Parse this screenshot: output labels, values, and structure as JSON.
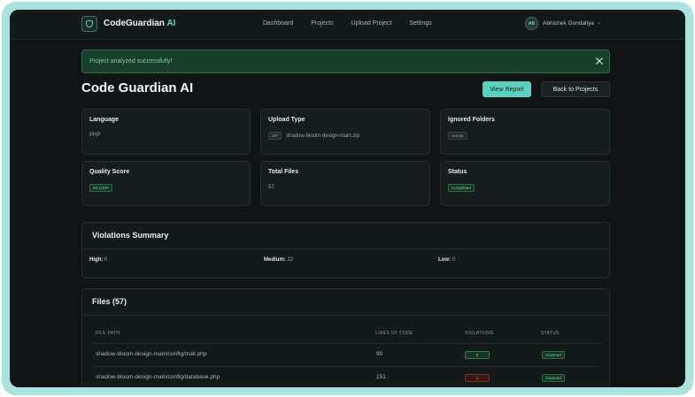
{
  "nav": {
    "brand_main": "CodeGuardian",
    "brand_accent": "AI",
    "links": [
      "Dashboard",
      "Projects",
      "Upload Project",
      "Settings"
    ],
    "user_initials": "AB",
    "user_name": "Abhishek Gondaliya"
  },
  "alert": {
    "message": "Project analyzed successfully!"
  },
  "page": {
    "title": "Code Guardian AI",
    "view_report": "View Report",
    "back_to_projects": "Back to Projects"
  },
  "cards": {
    "language": {
      "label": "Language",
      "value": "PHP"
    },
    "upload_type": {
      "label": "Upload Type",
      "tag": "ZIP",
      "value": "shadow-bloom-design-main.zip"
    },
    "ignored_folders": {
      "label": "Ignored Folders",
      "tag": "vendor"
    },
    "quality_score": {
      "label": "Quality Score",
      "badge": "98.1/100"
    },
    "total_files": {
      "label": "Total Files",
      "value": "57"
    },
    "status": {
      "label": "Status",
      "badge": "Completed"
    }
  },
  "violations": {
    "title": "Violations Summary",
    "high_label": "High:",
    "high_value": "0",
    "medium_label": "Medium:",
    "medium_value": "22",
    "low_label": "Low:",
    "low_value": "0"
  },
  "files": {
    "title": "Files (57)",
    "headers": [
      "FILE PATH",
      "LINES OF CODE",
      "VIOLATIONS",
      "STATUS"
    ],
    "rows": [
      {
        "path": "shadow-bloom-design-main/config/mail.php",
        "loc": "90",
        "violations": "0",
        "status": "Scanned"
      },
      {
        "path": "shadow-bloom-design-main/config/database.php",
        "loc": "151",
        "violations": "1",
        "status": "Scanned"
      }
    ]
  },
  "colors": {
    "accent": "#5ccfbe",
    "success": "#6fd39a",
    "danger": "#e07a7a",
    "background": "#101414"
  }
}
